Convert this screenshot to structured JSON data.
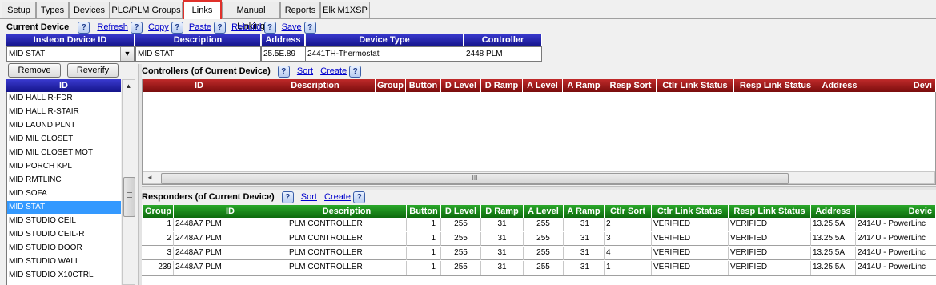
{
  "tabs": [
    {
      "label": "Setup"
    },
    {
      "label": "Types"
    },
    {
      "label": "Devices"
    },
    {
      "label": "PLC/PLM Groups"
    },
    {
      "label": "Links"
    },
    {
      "label": "Manual Linking"
    },
    {
      "label": "Reports"
    },
    {
      "label": "Elk M1XSP"
    }
  ],
  "toolbar": {
    "current_device_label": "Current Device",
    "refresh": "Refresh",
    "copy": "Copy",
    "paste": "Paste",
    "rebuild": "Rebuild",
    "save": "Save",
    "help_glyph": "?"
  },
  "device_header": {
    "id": "Insteon Device ID",
    "description": "Description",
    "address": "Address",
    "device_type": "Device Type",
    "controller": "Controller"
  },
  "device_values": {
    "id": "MID STAT",
    "description": "MID STAT",
    "address": "25.5E.89",
    "device_type": "2441TH-Thermostat",
    "controller": "2448 PLM"
  },
  "buttons": {
    "remove": "Remove",
    "reverify": "Reverify"
  },
  "id_list": {
    "header": "ID",
    "items": [
      "MID HALL R-FDR",
      "MID HALL R-STAIR",
      "MID LAUND PLNT",
      "MID MIL CLOSET",
      "MID MIL CLOSET MOT",
      "MID PORCH KPL",
      "MID RMTLINC",
      "MID SOFA",
      "MID STAT",
      "MID STUDIO CEIL",
      "MID STUDIO CEIL-R",
      "MID STUDIO DOOR",
      "MID STUDIO WALL",
      "MID STUDIO X10CTRL"
    ],
    "selected": "MID STAT"
  },
  "controllers": {
    "title": "Controllers (of Current Device)",
    "sort": "Sort",
    "create": "Create",
    "columns": [
      "ID",
      "Description",
      "Group",
      "Button",
      "D Level",
      "D Ramp",
      "A Level",
      "A Ramp",
      "Resp Sort",
      "Ctlr Link Status",
      "Resp Link Status",
      "Address",
      "Devi"
    ],
    "scroll_grip": "III"
  },
  "responders": {
    "title": "Responders (of Current Device)",
    "sort": "Sort",
    "create": "Create",
    "columns": [
      "Group",
      "ID",
      "Description",
      "Button",
      "D Level",
      "D Ramp",
      "A Level",
      "A Ramp",
      "Ctlr Sort",
      "Ctlr Link Status",
      "Resp Link Status",
      "Address",
      "Devic"
    ],
    "rows": [
      [
        "1",
        "2448A7 PLM",
        "PLM CONTROLLER",
        "1",
        "255",
        "31",
        "255",
        "31",
        "2",
        "VERIFIED",
        "VERIFIED",
        "13.25.5A",
        "2414U - PowerLinc"
      ],
      [
        "2",
        "2448A7 PLM",
        "PLM CONTROLLER",
        "1",
        "255",
        "31",
        "255",
        "31",
        "3",
        "VERIFIED",
        "VERIFIED",
        "13.25.5A",
        "2414U - PowerLinc"
      ],
      [
        "3",
        "2448A7 PLM",
        "PLM CONTROLLER",
        "1",
        "255",
        "31",
        "255",
        "31",
        "4",
        "VERIFIED",
        "VERIFIED",
        "13.25.5A",
        "2414U - PowerLinc"
      ],
      [
        "239",
        "2448A7 PLM",
        "PLM CONTROLLER",
        "1",
        "255",
        "31",
        "255",
        "31",
        "1",
        "VERIFIED",
        "VERIFIED",
        "13.25.5A",
        "2414U - PowerLinc"
      ]
    ]
  }
}
